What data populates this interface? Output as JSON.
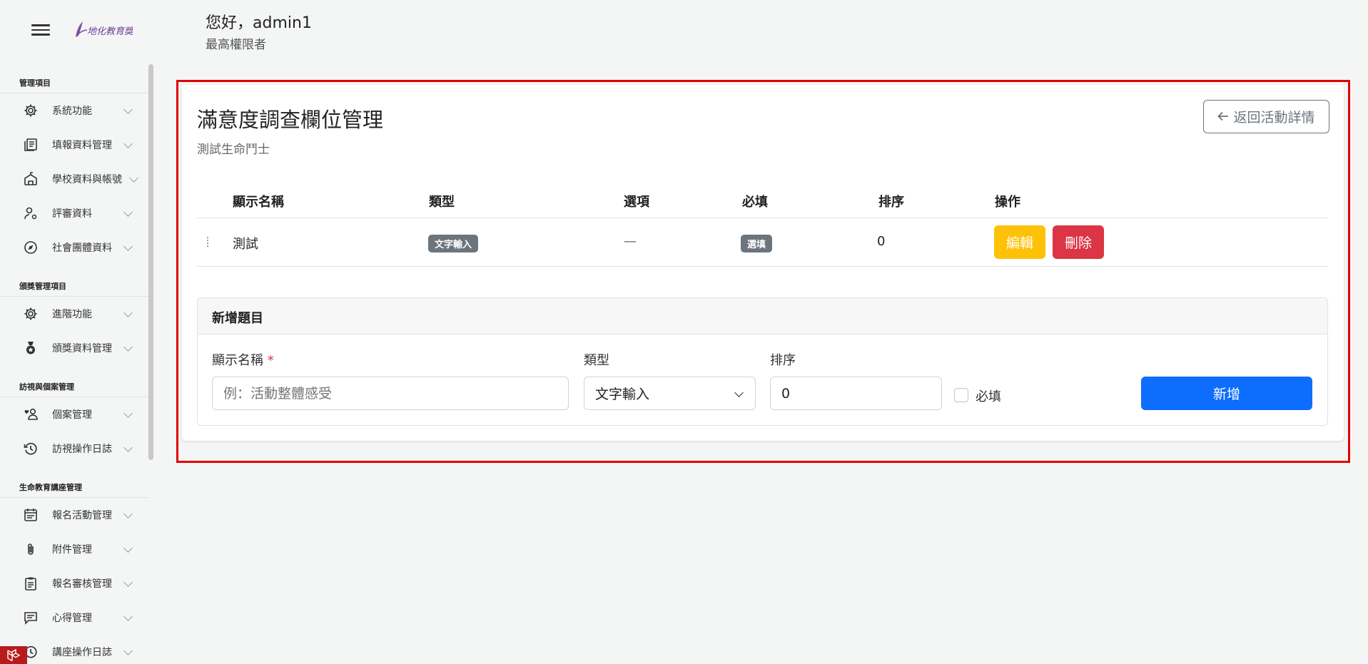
{
  "header": {
    "greeting_prefix": "您好，",
    "username": "admin1",
    "role": "最高權限者"
  },
  "sidebar": {
    "sections": [
      {
        "title": "管理項目",
        "items": [
          {
            "label": "系統功能",
            "icon": "gear-icon"
          },
          {
            "label": "填報資料管理",
            "icon": "document-list-icon"
          },
          {
            "label": "學校資料與帳號",
            "icon": "school-icon"
          },
          {
            "label": "評審資料",
            "icon": "user-gear-icon"
          },
          {
            "label": "社會團體資料",
            "icon": "compass-icon"
          }
        ]
      },
      {
        "title": "頒獎管理項目",
        "items": [
          {
            "label": "進階功能",
            "icon": "gear-icon"
          },
          {
            "label": "頒獎資料管理",
            "icon": "medal-icon"
          }
        ]
      },
      {
        "title": "訪視與個案管理",
        "items": [
          {
            "label": "個案管理",
            "icon": "heart-person-icon"
          },
          {
            "label": "訪視操作日誌",
            "icon": "history-icon"
          }
        ]
      },
      {
        "title": "生命教育講座管理",
        "items": [
          {
            "label": "報名活動管理",
            "icon": "calendar-list-icon"
          },
          {
            "label": "附件管理",
            "icon": "paperclip-icon"
          },
          {
            "label": "報名審核管理",
            "icon": "clipboard-check-icon"
          },
          {
            "label": "心得管理",
            "icon": "comment-icon"
          },
          {
            "label": "講座操作日誌",
            "icon": "history-icon"
          }
        ]
      }
    ]
  },
  "card": {
    "title": "滿意度調查欄位管理",
    "subtitle": "測試生命鬥士",
    "back_button": "返回活動詳情",
    "columns": [
      "顯示名稱",
      "類型",
      "選項",
      "必填",
      "排序",
      "操作"
    ],
    "rows": [
      {
        "name": "測試",
        "type": "文字輸入",
        "options": "—",
        "required": "選填",
        "order": "0",
        "edit": "編輯",
        "delete": "刪除"
      }
    ]
  },
  "add_panel": {
    "title": "新增題目",
    "name_label": "顯示名稱",
    "required_mark": "*",
    "name_placeholder": "例：活動整體感受",
    "type_label": "類型",
    "type_value": "文字輸入",
    "order_label": "排序",
    "order_value": "0",
    "required_label": "必填",
    "submit": "新增"
  },
  "colors": {
    "primary": "#0d6efd",
    "warning": "#ffc107",
    "danger": "#dc3545",
    "secondary": "#6c757d",
    "highlight": "#e00000"
  }
}
